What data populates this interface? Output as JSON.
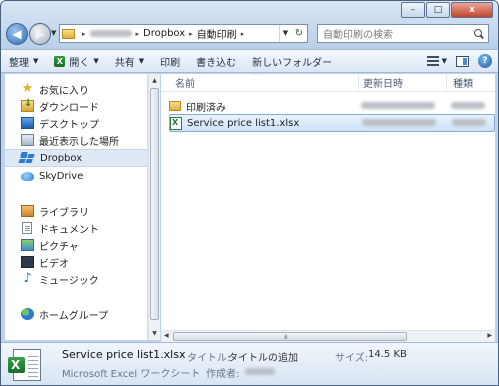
{
  "window": {
    "caption_buttons": {
      "minimize": "–",
      "maximize": "□",
      "close": "x"
    }
  },
  "nav": {
    "back_glyph": "◀",
    "forward_glyph": "▶",
    "history_glyph": "▼"
  },
  "address": {
    "separator": "▸",
    "crumbs": [
      "Dropbox",
      "自動印刷"
    ],
    "dropdown_glyph": "▼",
    "refresh_glyph": "↻"
  },
  "search": {
    "placeholder": "自動印刷の検索"
  },
  "toolbar": {
    "organize": "整理",
    "open": "開く",
    "share": "共有",
    "print": "印刷",
    "burn": "書き込む",
    "new_folder": "新しいフォルダー",
    "dropdown_glyph": "▼",
    "help_glyph": "?"
  },
  "sidebar": {
    "favorites": "お気に入り",
    "downloads": "ダウンロード",
    "desktop": "デスクトップ",
    "recent": "最近表示した場所",
    "dropbox": "Dropbox",
    "skydrive": "SkyDrive",
    "libraries": "ライブラリ",
    "documents": "ドキュメント",
    "pictures": "ピクチャ",
    "videos": "ビデオ",
    "music": "ミュージック",
    "homegroup": "ホームグループ",
    "scroll_up": "▲",
    "scroll_down": "▼",
    "icons": {
      "star": "★",
      "music": "♪"
    }
  },
  "filelist": {
    "columns": {
      "name": "名前",
      "date": "更新日時",
      "type": "種類"
    },
    "sort_glyph": "^",
    "rows": [
      {
        "name": "印刷済み",
        "kind": "folder"
      },
      {
        "name": "Service price list1.xlsx",
        "kind": "xlsx"
      }
    ]
  },
  "hscroll": {
    "left": "◀",
    "right": "▶",
    "grip": "⁞⁞⁞"
  },
  "details": {
    "file_name": "Service price list1.xlsx",
    "file_type": "Microsoft Excel ワークシート",
    "title_label": "タイトル:",
    "title_value": "タイトルの追加",
    "size_label": "サイズ:",
    "size_value": "14.5 KB",
    "author_label": "作成者:"
  }
}
